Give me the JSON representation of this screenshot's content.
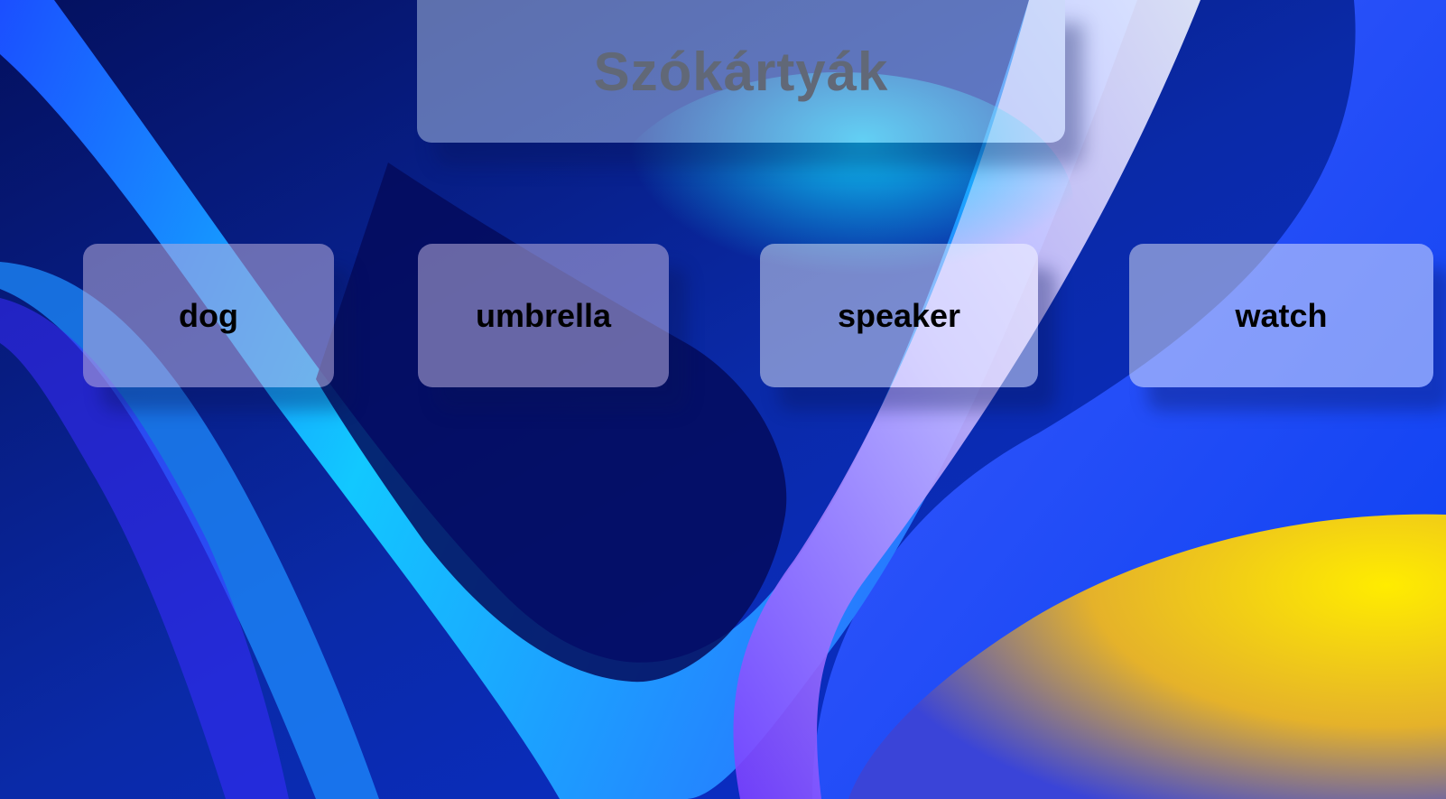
{
  "title": "Szókártyák",
  "cards": [
    {
      "label": "dog"
    },
    {
      "label": "umbrella"
    },
    {
      "label": "speaker"
    },
    {
      "label": "watch"
    }
  ],
  "colors": {
    "background_dark": "#040a5a",
    "accent_blue": "#1e7bff",
    "accent_cyan": "#11d6ff",
    "accent_violet": "#9a7cff",
    "accent_yellow": "#f7e400",
    "title_text": "#616877",
    "card_text": "#000000"
  }
}
